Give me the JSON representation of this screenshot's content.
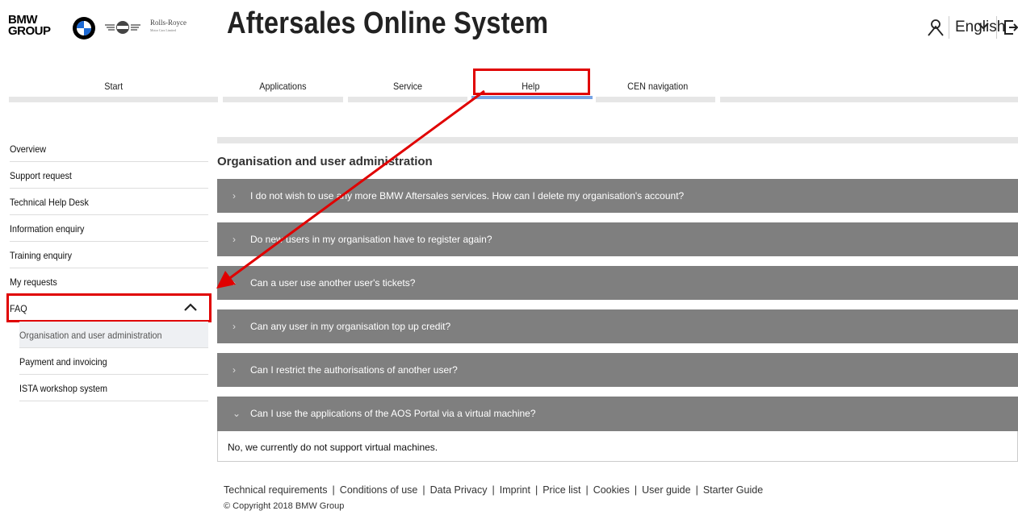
{
  "header": {
    "brand_line1": "BMW",
    "brand_line2": "GROUP",
    "rr_logo_text": "Rolls-Royce",
    "rr_logo_sub": "Motor Cars Limited",
    "title": "Aftersales Online System",
    "language": "English"
  },
  "nav": {
    "items": [
      {
        "label": "Start"
      },
      {
        "label": "Applications"
      },
      {
        "label": "Service"
      },
      {
        "label": "Help"
      },
      {
        "label": "CEN navigation"
      }
    ],
    "active": "Help"
  },
  "sidebar": {
    "items": [
      {
        "label": "Overview"
      },
      {
        "label": "Support request"
      },
      {
        "label": "Technical Help Desk"
      },
      {
        "label": "Information enquiry"
      },
      {
        "label": "Training enquiry"
      },
      {
        "label": "My requests"
      },
      {
        "label": "FAQ"
      }
    ],
    "faq_sub": [
      {
        "label": "Organisation and user administration"
      },
      {
        "label": "Payment and invoicing"
      },
      {
        "label": "ISTA workshop system"
      }
    ],
    "faq_sub_active": "Organisation and user administration"
  },
  "main": {
    "section_title": "Organisation and user administration",
    "faqs": [
      {
        "question": "I do not wish to use any more BMW Aftersales services. How can I delete my organisation's account?",
        "expanded": false
      },
      {
        "question": "Do new users in my organisation have to register again?",
        "expanded": false
      },
      {
        "question": "Can a user use another user's tickets?",
        "expanded": false
      },
      {
        "question": "Can any user in my organisation top up credit?",
        "expanded": false
      },
      {
        "question": "Can I restrict the authorisations of another user?",
        "expanded": false
      },
      {
        "question": "Can I use the applications of the AOS Portal via a virtual machine?",
        "expanded": true
      }
    ],
    "answer": "No, we currently do not support virtual machines."
  },
  "footer": {
    "links": [
      {
        "label": "Technical requirements"
      },
      {
        "label": "Conditions of use"
      },
      {
        "label": "Data Privacy"
      },
      {
        "label": "Imprint"
      },
      {
        "label": "Price list"
      },
      {
        "label": "Cookies"
      },
      {
        "label": "User guide"
      },
      {
        "label": "Starter Guide"
      }
    ],
    "separator": "|",
    "copyright": "© Copyright 2018 BMW Group"
  },
  "colors": {
    "faq_row_bg": "#7f7f7f",
    "highlight_red": "#e00000",
    "accent_blue": "#1c69d4",
    "nav_bar": "#e6e6e6"
  },
  "icons": [
    "bmw-roundel-icon",
    "mini-logo-icon",
    "user-icon",
    "chevron-down-icon",
    "logout-icon",
    "chevron-up-icon",
    "chevron-right-icon",
    "chevron-down-icon"
  ]
}
